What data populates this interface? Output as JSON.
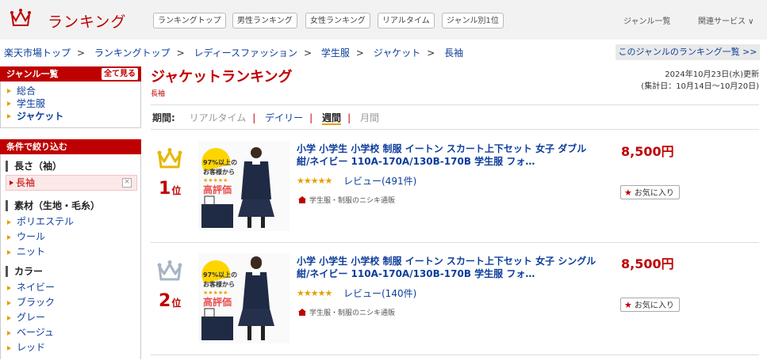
{
  "header": {
    "logo_text": "ランキング",
    "nav": [
      "ランキングトップ",
      "男性ランキング",
      "女性ランキング",
      "リアルタイム",
      "ジャンル別1位"
    ],
    "genre_list": "ジャンル一覧",
    "related": "関連サービス ∨"
  },
  "breadcrumb": [
    "楽天市場トップ",
    "ランキングトップ",
    "レディースファッション",
    "学生服",
    "ジャケット",
    "長袖"
  ],
  "breadcrumb_sep": ">",
  "genre_ranking_link": "このジャンルのランキング一覧 >>",
  "sidebar": {
    "genre_title": "ジャンル一覧",
    "see_all": "全て見る",
    "genres": [
      "総合",
      "学生服",
      "ジャケット"
    ],
    "filter_title": "条件で絞り込む",
    "groups": [
      {
        "title": "長さ（袖）",
        "selected": "長袖",
        "items": []
      },
      {
        "title": "素材（生地・毛糸）",
        "items": [
          "ポリエステル",
          "ウール",
          "ニット"
        ]
      },
      {
        "title": "カラー",
        "items": [
          "ネイビー",
          "ブラック",
          "グレー",
          "ベージュ",
          "レッド"
        ]
      }
    ]
  },
  "main": {
    "title": "ジャケットランキング",
    "subtitle": "長袖",
    "updated": "2024年10月23日(水)更新",
    "period_range": "(集計日：10月14日～10月20日)",
    "period_label": "期間:",
    "periods": [
      "リアルタイム",
      "デイリー",
      "週間",
      "月間"
    ],
    "period_sep": "|"
  },
  "items": [
    {
      "rank": "1",
      "rank_suffix": "位",
      "name": "小学 小学生 小学校 制服 イートン スカート上下セット 女子 ダブル 紺/ネイビー 110A-170A/130B-170B 学生服 フォ…",
      "stars": "★★★★★",
      "review": "レビュー(491件)",
      "shop": "学生服・制服のニシキ通販",
      "price": "8,500円",
      "fav": "お気に入り",
      "thumb_badge_top": "97%以上の",
      "thumb_badge_mid": "お客様から",
      "thumb_badge_big": "高評価",
      "crown_color": "#e5b800"
    },
    {
      "rank": "2",
      "rank_suffix": "位",
      "name": "小学 小学生 小学校 制服 イートン スカート上下セット 女子 シングル 紺/ネイビー 110A-170A/130B-170B 学生服 フォ…",
      "stars": "★★★★★",
      "review": "レビュー(140件)",
      "shop": "学生服・制服のニシキ通販",
      "price": "8,500円",
      "fav": "お気に入り",
      "thumb_badge_top": "97%以上の",
      "thumb_badge_mid": "お客様から",
      "thumb_badge_big": "高評価",
      "crown_color": "#a8b4c4"
    }
  ]
}
